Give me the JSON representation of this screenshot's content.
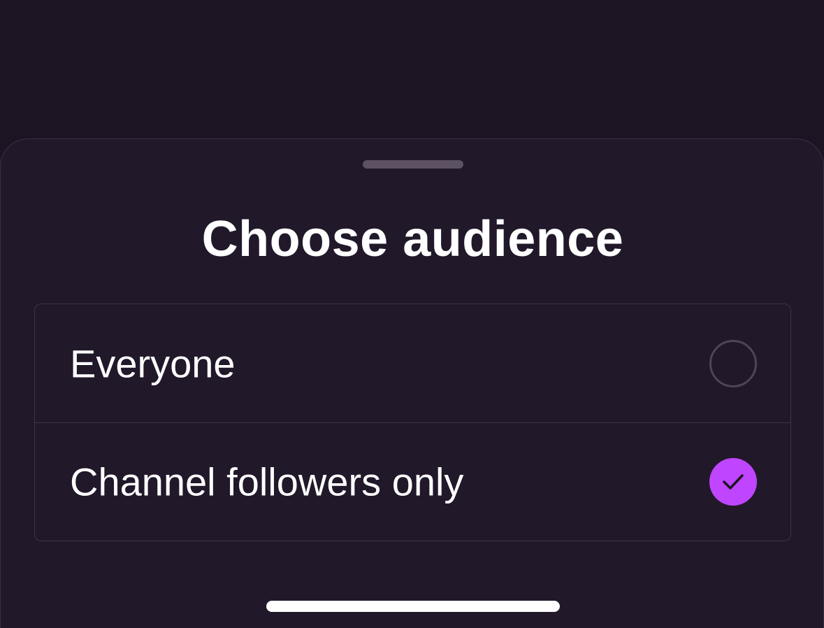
{
  "sheet": {
    "title": "Choose audience",
    "options": [
      {
        "label": "Everyone",
        "selected": false
      },
      {
        "label": "Channel followers only",
        "selected": true
      }
    ]
  },
  "colors": {
    "background": "#1c1422",
    "sheet": "#21182a",
    "accent": "#bf45ff",
    "border": "#3f3547"
  },
  "icons": {
    "selected_indicator": "checkmark-icon"
  }
}
